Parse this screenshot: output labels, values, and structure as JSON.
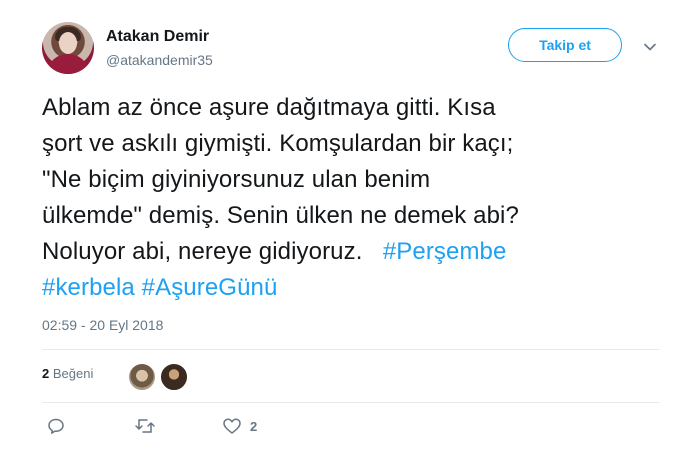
{
  "author": {
    "name": "Atakan Demir",
    "handle": "@atakandemir35"
  },
  "follow_button": {
    "label": "Takip et"
  },
  "tweet": {
    "lines": [
      "Ablam az önce aşure dağıtmaya gitti. Kısa",
      "şort ve askılı giymişti. Komşulardan bir kaçı;",
      "\"Ne biçim giyiniyorsunuz ulan benim",
      "ülkemde\" demiş. Senin ülken ne demek abi?",
      "Noluyor abi, nereye gidiyoruz."
    ],
    "hashtags_line5": "#Perşembe",
    "hashtags_line6": [
      "#kerbela",
      "#AşureGünü"
    ]
  },
  "timestamp": "02:59 - 20 Eyl 2018",
  "likes": {
    "count": "2",
    "label": "Beğeni"
  },
  "actions": {
    "reply_icon": "reply-icon",
    "retweet_icon": "retweet-icon",
    "like_icon": "heart-icon",
    "like_count": "2"
  },
  "colors": {
    "accent": "#1da1f2",
    "text": "#14171a",
    "muted": "#657786",
    "divider": "#e6ecf0"
  }
}
